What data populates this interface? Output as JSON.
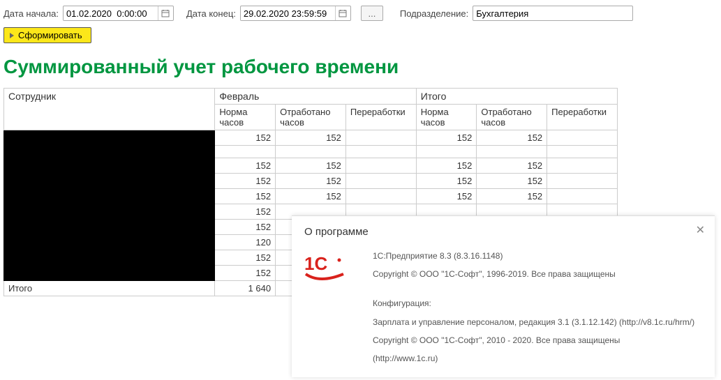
{
  "toolbar": {
    "date_start_label": "Дата начала:",
    "date_start_value": "01.02.2020  0:00:00",
    "date_end_label": "Дата конец:",
    "date_end_value": "29.02.2020 23:59:59",
    "dept_label": "Подразделение:",
    "dept_value": "Бухгалтерия",
    "extra_btn": "...",
    "form_btn": "Сформировать"
  },
  "report": {
    "title": "Суммированный учет рабочего времени",
    "col_employee": "Сотрудник",
    "group_month": "Февраль",
    "group_total": "Итого",
    "col_norm": "Норма часов",
    "col_worked": "Отработано часов",
    "col_over": "Переработки",
    "rows": [
      {
        "norm": "152",
        "worked": "152",
        "over": "",
        "t_norm": "152",
        "t_worked": "152",
        "t_over": ""
      },
      {
        "norm": "",
        "worked": "",
        "over": "",
        "t_norm": "",
        "t_worked": "",
        "t_over": ""
      },
      {
        "norm": "152",
        "worked": "152",
        "over": "",
        "t_norm": "152",
        "t_worked": "152",
        "t_over": ""
      },
      {
        "norm": "152",
        "worked": "152",
        "over": "",
        "t_norm": "152",
        "t_worked": "152",
        "t_over": ""
      },
      {
        "norm": "152",
        "worked": "152",
        "over": "",
        "t_norm": "152",
        "t_worked": "152",
        "t_over": ""
      },
      {
        "norm": "152",
        "worked": "",
        "over": "",
        "t_norm": "",
        "t_worked": "",
        "t_over": ""
      },
      {
        "norm": "152",
        "worked": "",
        "over": "",
        "t_norm": "",
        "t_worked": "",
        "t_over": ""
      },
      {
        "norm": "120",
        "worked": "",
        "over": "",
        "t_norm": "",
        "t_worked": "",
        "t_over": ""
      },
      {
        "norm": "152",
        "worked": "",
        "over": "",
        "t_norm": "",
        "t_worked": "",
        "t_over": ""
      },
      {
        "norm": "152",
        "worked": "",
        "over": "",
        "t_norm": "",
        "t_worked": "",
        "t_over": ""
      }
    ],
    "total_label": "Итого",
    "total_norm": "1 640"
  },
  "about": {
    "title": "О программе",
    "line1": "1С:Предприятие 8.3 (8.3.16.1148)",
    "line2": "Copyright © ООО \"1С-Софт\", 1996-2019. Все права защищены",
    "line3": "Конфигурация:",
    "line4": "Зарплата и управление персоналом, редакция 3.1 (3.1.12.142) (http://v8.1c.ru/hrm/)",
    "line5": "Copyright © ООО \"1С-Софт\", 2010 - 2020. Все права защищены",
    "line6": "(http://www.1c.ru)"
  }
}
